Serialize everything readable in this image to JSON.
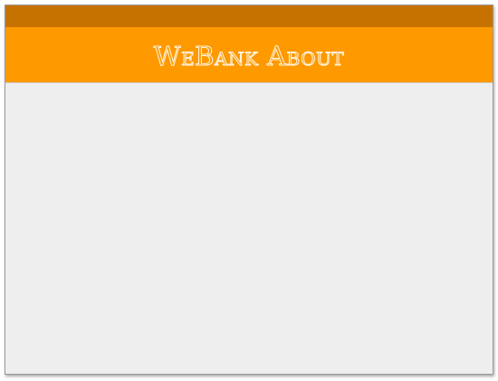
{
  "window": {
    "titlebar_color": "#c67200",
    "header_color": "#ff9900",
    "content_color": "#eeeeee"
  },
  "header": {
    "title": "WeBank About"
  }
}
